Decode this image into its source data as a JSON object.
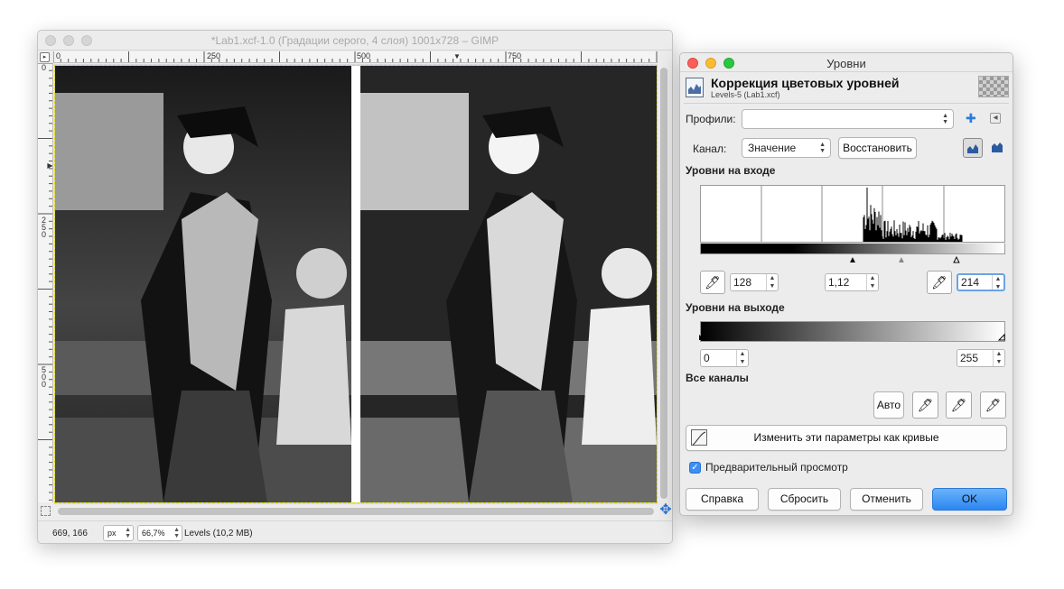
{
  "gimp_window": {
    "title": "*Lab1.xcf-1.0 (Градации серого, 4 слоя) 1001x728 – GIMP",
    "ruler_top_labels": [
      "0",
      "250",
      "500",
      "750"
    ],
    "ruler_left_labels": [
      "0",
      "2\n5\n0",
      "5\n0\n0"
    ],
    "ruler_corner_icon": "triangle-right-icon",
    "status": {
      "coords": "669, 166",
      "unit": "px",
      "zoom": "66,7%",
      "message": "Levels (10,2 MB)"
    },
    "navigate_icon": "move-arrows-icon"
  },
  "levels_dialog": {
    "window_title": "Уровни",
    "header_title": "Коррекция цветовых уровней",
    "header_subtitle": "Levels-5 (Lab1.xcf)",
    "presets_label": "Профили:",
    "presets_value": "",
    "channel_label": "Канал:",
    "channel_value": "Значение",
    "reset_channel_label": "Восстановить",
    "input_levels_label": "Уровни на входе",
    "input_low": "128",
    "input_gamma": "1,12",
    "input_high": "214",
    "output_levels_label": "Уровни на выходе",
    "output_low": "0",
    "output_high": "255",
    "all_channels_label": "Все каналы",
    "auto_label": "Авто",
    "edit_as_curves_label": "Изменить эти параметры как кривые",
    "preview_label": "Предварительный просмотр",
    "preview_checked": true,
    "buttons": {
      "help": "Справка",
      "reset": "Сбросить",
      "cancel": "Отменить",
      "ok": "OK"
    },
    "accent_color": "#2a86f2"
  }
}
